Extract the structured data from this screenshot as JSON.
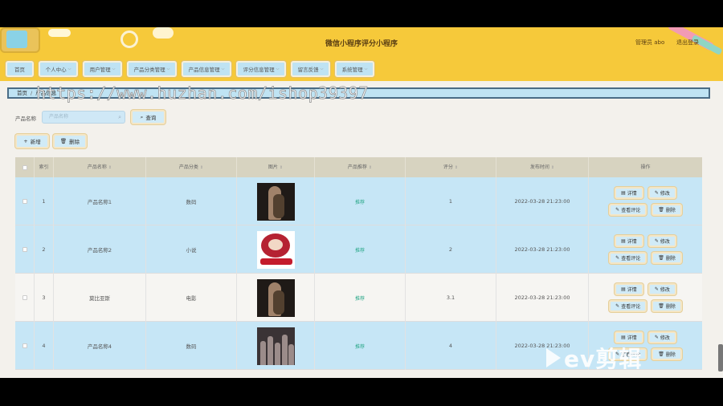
{
  "header": {
    "title": "微信小程序评分小程序",
    "user": "管理员 abo",
    "logout": "退出登录"
  },
  "nav": {
    "items": [
      {
        "label": "首页",
        "has_menu": false
      },
      {
        "label": "个人中心",
        "has_menu": true
      },
      {
        "label": "用户管理",
        "has_menu": true
      },
      {
        "label": "产品分类管理",
        "has_menu": true
      },
      {
        "label": "产品信息管理",
        "has_menu": true
      },
      {
        "label": "评分信息管理",
        "has_menu": true
      },
      {
        "label": "留言反馈",
        "has_menu": true
      },
      {
        "label": "系统管理",
        "has_menu": true
      }
    ]
  },
  "breadcrumb": {
    "home": "首页",
    "separator": "/",
    "current": "产品信息"
  },
  "watermark": "https://www.huzhan.com/ishop39397",
  "search": {
    "label": "产品名称",
    "placeholder": "产品名称",
    "button": "查询"
  },
  "actions": {
    "add": "新增",
    "delete": "删除"
  },
  "table": {
    "columns": [
      "索引",
      "产品名称",
      "产品分类",
      "图片",
      "产品推荐",
      "评分",
      "发布时间",
      "操作"
    ],
    "rows": [
      {
        "index": "1",
        "name": "产品名称1",
        "category": "数码",
        "status": "推荐",
        "score": "1",
        "time": "2022-03-28 21:23:00",
        "image": "dark"
      },
      {
        "index": "2",
        "name": "产品名称2",
        "category": "小说",
        "status": "推荐",
        "score": "2",
        "time": "2022-03-28 21:23:00",
        "image": "white"
      },
      {
        "index": "3",
        "name": "莫比亚斯",
        "category": "电影",
        "status": "推荐",
        "score": "3.1",
        "time": "2022-03-28 21:23:00",
        "image": "dark"
      },
      {
        "index": "4",
        "name": "产品名称4",
        "category": "数码",
        "status": "推荐",
        "score": "4",
        "time": "2022-03-28 21:23:00",
        "image": "crowd"
      }
    ],
    "ops": {
      "detail": "详情",
      "edit": "修改",
      "comments": "查看评论",
      "delete": "删除"
    }
  },
  "overlay_logo": "ev剪辑"
}
